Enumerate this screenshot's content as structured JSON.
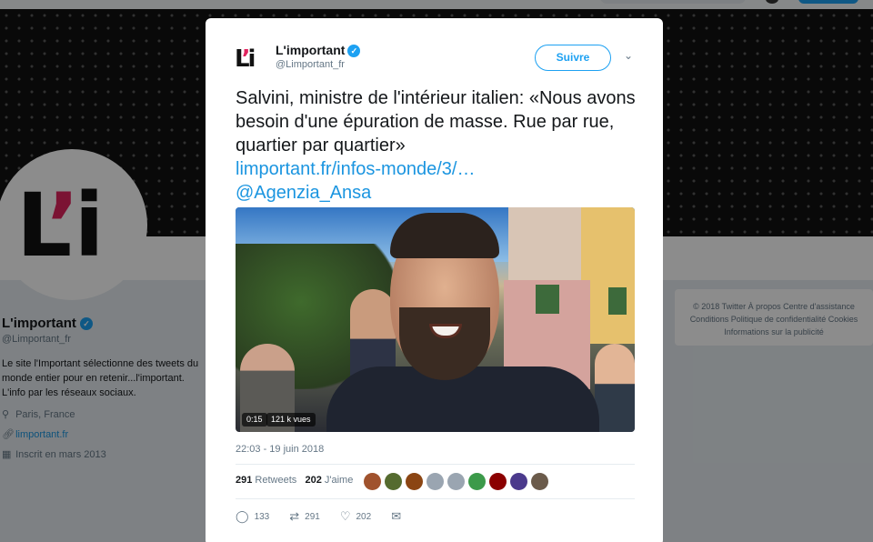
{
  "profile": {
    "name": "L'important",
    "handle": "@Limportant_fr",
    "bio": "Le site l'Important sélectionne des tweets du monde entier pour en retenir...l'important. L'info par les réseaux sociaux.",
    "location": "Paris, France",
    "website": "limportant.fr",
    "joined": "Inscrit en mars 2013",
    "avatar_logo": "L'i"
  },
  "footer": {
    "line1": "© 2018 Twitter   À propos   Centre d'assistance",
    "line2": "Conditions   Politique de confidentialité   Cookies",
    "line3": "Informations sur la publicité"
  },
  "tweet": {
    "author_name": "L'important",
    "author_handle": "@Limportant_fr",
    "avatar_logo": "L'i",
    "follow_label": "Suivre",
    "text": "Salvini, ministre de l'intérieur italien: «Nous avons besoin d'une épuration de masse. Rue par rue, quartier par quartier»",
    "link": "limportant.fr/infos-monde/3/…",
    "mention": "@Agenzia_Ansa",
    "video": {
      "duration": "0:15",
      "views": "121 k vues"
    },
    "timestamp": "22:03 - 19 juin 2018",
    "retweets_count": "291",
    "retweets_label": "Retweets",
    "likes_count": "202",
    "likes_label": "J'aime",
    "liker_avatar_colors": [
      "#a0522d",
      "#556b2f",
      "#8b4513",
      "#9aa5b1",
      "#9aa5b1",
      "#3c9a4a",
      "#8b0000",
      "#4b3a8c",
      "#6b5b4b"
    ],
    "actions": {
      "reply_count": "133",
      "retweet_count": "291",
      "like_count": "202"
    }
  },
  "icons": {
    "verified": "verified-badge-icon",
    "location": "location-pin-icon",
    "link": "link-icon",
    "calendar": "calendar-icon",
    "caret": "chevron-down-icon",
    "reply": "reply-icon",
    "retweet": "retweet-icon",
    "like": "heart-icon",
    "dm": "envelope-icon"
  },
  "colors": {
    "accent": "#1da1f2",
    "link": "#1b95e0",
    "text": "#14171a",
    "secondary": "#657786"
  }
}
